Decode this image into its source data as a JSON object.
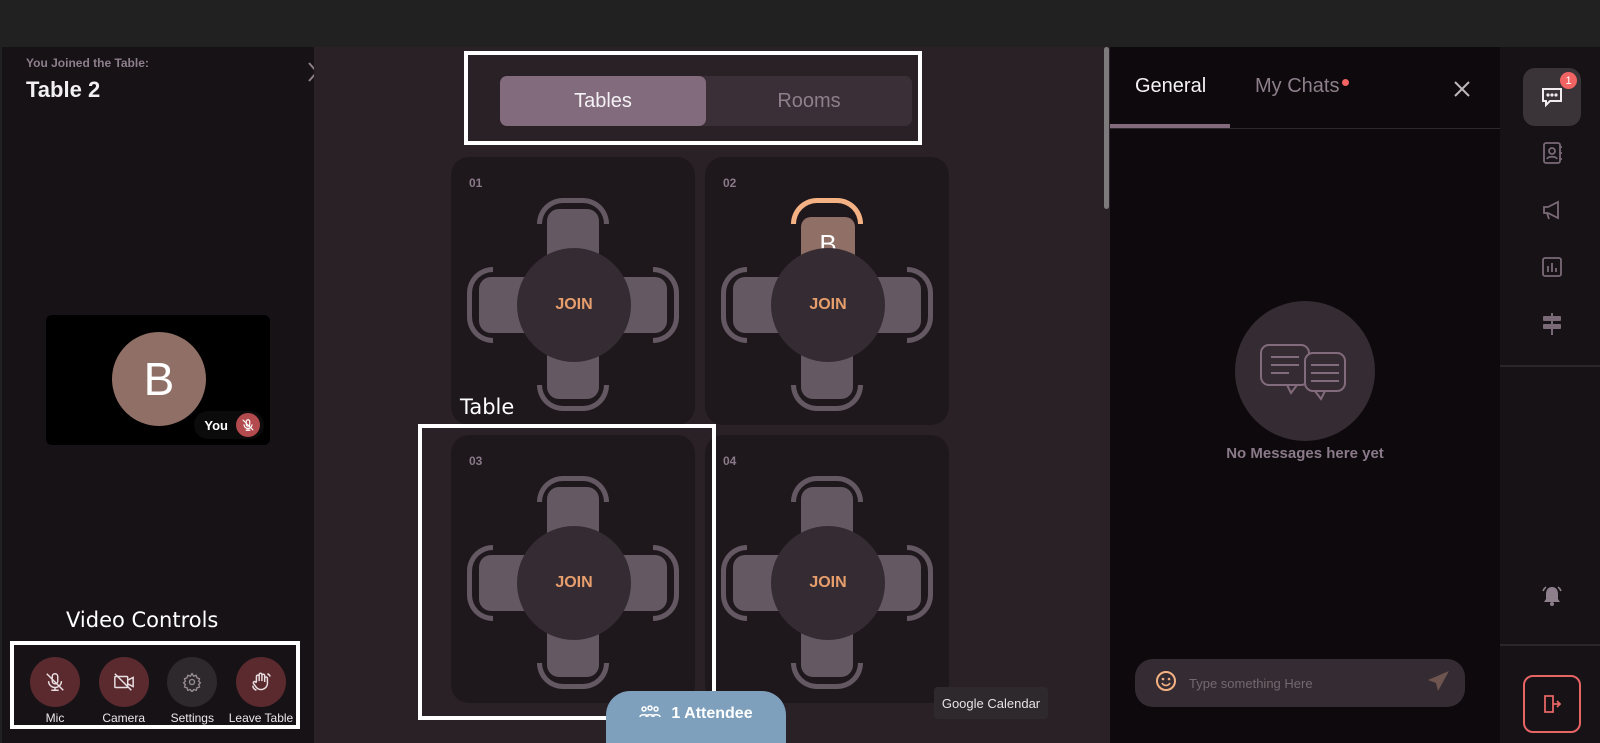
{
  "left_panel": {
    "joined_label": "You Joined the Table:",
    "table_name": "Table 2",
    "video_tile": {
      "avatar_initial": "B",
      "you_label": "You",
      "mic_state": "muted"
    },
    "controls": [
      {
        "label": "Mic",
        "icon": "mic-off-icon",
        "state": "off"
      },
      {
        "label": "Camera",
        "icon": "camera-off-icon",
        "state": "off"
      },
      {
        "label": "Settings",
        "icon": "gear-icon",
        "state": "neutral"
      },
      {
        "label": "Leave Table",
        "icon": "wave-hand-icon",
        "state": "danger"
      }
    ]
  },
  "annotations": {
    "video_controls": "Video Controls",
    "table": "Table"
  },
  "center": {
    "segment": {
      "tables_label": "Tables",
      "rooms_label": "Rooms",
      "active": "Tables"
    },
    "tables": [
      {
        "number": "01",
        "join_label": "JOIN",
        "occupant_initial": null
      },
      {
        "number": "02",
        "join_label": "JOIN",
        "occupant_initial": "B"
      },
      {
        "number": "03",
        "join_label": "JOIN",
        "occupant_initial": null
      },
      {
        "number": "04",
        "join_label": "JOIN",
        "occupant_initial": null
      }
    ],
    "attendee_label": "1 Attendee",
    "tooltip": "Google Calendar"
  },
  "chat": {
    "tab_general": "General",
    "tab_my_chats": "My Chats",
    "my_chats_unread": true,
    "empty_text": "No Messages here yet",
    "input_placeholder": "Type something Here"
  },
  "rail": {
    "items": [
      {
        "name": "chat",
        "icon": "chat-icon",
        "badge": "1",
        "active": true
      },
      {
        "name": "contacts",
        "icon": "contact-book-icon"
      },
      {
        "name": "announcements",
        "icon": "megaphone-icon"
      },
      {
        "name": "polls",
        "icon": "bar-chart-icon"
      },
      {
        "name": "directions",
        "icon": "signpost-icon"
      }
    ],
    "notifications_icon": "bell-icon",
    "logout_icon": "exit-icon"
  },
  "colors": {
    "accent": "#826b7c",
    "join_text": "#e79e6d",
    "danger": "#e56565",
    "badge": "#f26363",
    "attendee_pill": "#7ea0bc"
  }
}
